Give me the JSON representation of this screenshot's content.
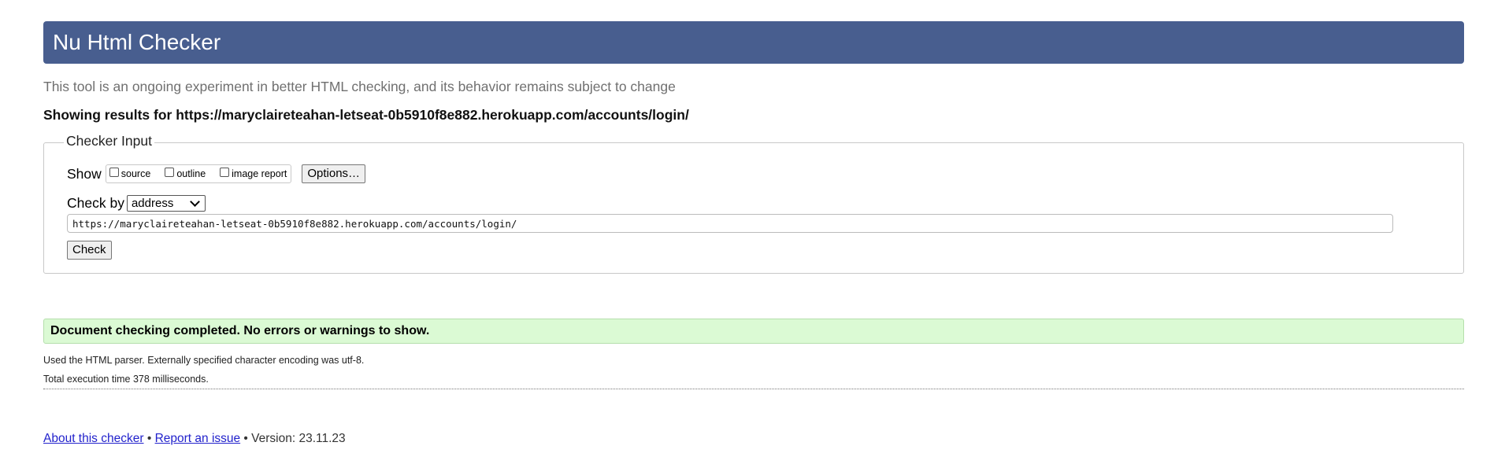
{
  "header": {
    "title": "Nu Html Checker"
  },
  "tagline": "This tool is an ongoing experiment in better HTML checking, and its behavior remains subject to change",
  "results": {
    "prefix": "Showing results for ",
    "url": "https://maryclaireteahan-letseat-0b5910f8e882.herokuapp.com/accounts/login/"
  },
  "form": {
    "legend": "Checker Input",
    "show_label": "Show",
    "show_options": [
      {
        "label": "source",
        "checked": false
      },
      {
        "label": "outline",
        "checked": false
      },
      {
        "label": "image report",
        "checked": false
      }
    ],
    "options_button": "Options…",
    "check_by_label": "Check by",
    "check_by_selected": "address",
    "url_value": "https://maryclaireteahan-letseat-0b5910f8e882.herokuapp.com/accounts/login/",
    "check_button": "Check"
  },
  "status": {
    "message": "Document checking completed. No errors or warnings to show.",
    "parser_info": "Used the HTML parser. Externally specified character encoding was utf-8.",
    "execution_time": "Total execution time 378 milliseconds."
  },
  "footer": {
    "about_link": "About this checker",
    "separator": " • ",
    "report_link": "Report an issue",
    "version": "Version: 23.11.23"
  },
  "colors": {
    "header_bg": "#485e8f",
    "success_bg": "#dbfad4",
    "link": "#2222cc"
  }
}
